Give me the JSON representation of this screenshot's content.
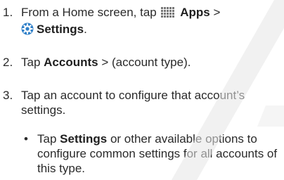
{
  "steps": [
    {
      "number": "1.",
      "text_before": "From a Home screen, tap",
      "apps_label": "Apps",
      "separator": ">",
      "settings_label": "Settings",
      "end": "."
    },
    {
      "number": "2.",
      "text_before": "Tap",
      "accounts_label": "Accounts",
      "text_after": "> (account type)."
    },
    {
      "number": "3.",
      "text": "Tap an account to configure that account’s settings."
    }
  ],
  "bullet": {
    "symbol": "•",
    "text_before": "Tap",
    "settings_label": "Settings",
    "text_after": "or other available options to configure common settings for all accounts of this type."
  },
  "icons": {
    "apps": "apps-grid-icon",
    "settings": "settings-gear-icon"
  },
  "colors": {
    "text": "#2a2a2a",
    "icon_grid": "#777777",
    "settings_icon_blue": "#2f7fc8",
    "watermark": "#e5e5e5"
  }
}
